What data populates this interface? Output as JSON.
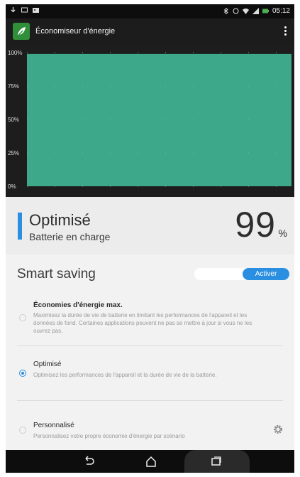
{
  "app": {
    "title": "Économiseur d'énergie"
  },
  "statusbar": {
    "time": "05:12"
  },
  "chart_data": {
    "type": "area",
    "yticks": [
      "100%",
      "75%",
      "50%",
      "25%",
      "0%"
    ],
    "ylim": [
      0,
      100
    ],
    "values": [
      99,
      99
    ],
    "color": "#3ea88b",
    "grid": true
  },
  "status": {
    "title": "Optimisé",
    "subtitle": "Batterie en charge",
    "percent": "99",
    "percent_sign": "%"
  },
  "smart_saving": {
    "title": "Smart saving",
    "toggle_label": "Activer",
    "options": [
      {
        "title": "Économies d'énergie max.",
        "desc": "Maximisez la durée de vie de batterie en limitant les performances de l'appareil et les données de fond. Certaines applications peuvent ne pas se mettre à jour si vous ne les ouvrez pas.",
        "selected": false
      },
      {
        "title": "Optimisé",
        "desc": "Optimisez les performances de l'appareil et la durée de vie de la batterie.",
        "selected": true
      },
      {
        "title": "Personnalisé",
        "desc": "Personnalisez votre propre économie d'énergie par scénario",
        "selected": false
      }
    ]
  },
  "colors": {
    "accent": "#2a8fe0",
    "chart_fill": "#3ea88b",
    "app_icon": "#2f8f3a"
  }
}
